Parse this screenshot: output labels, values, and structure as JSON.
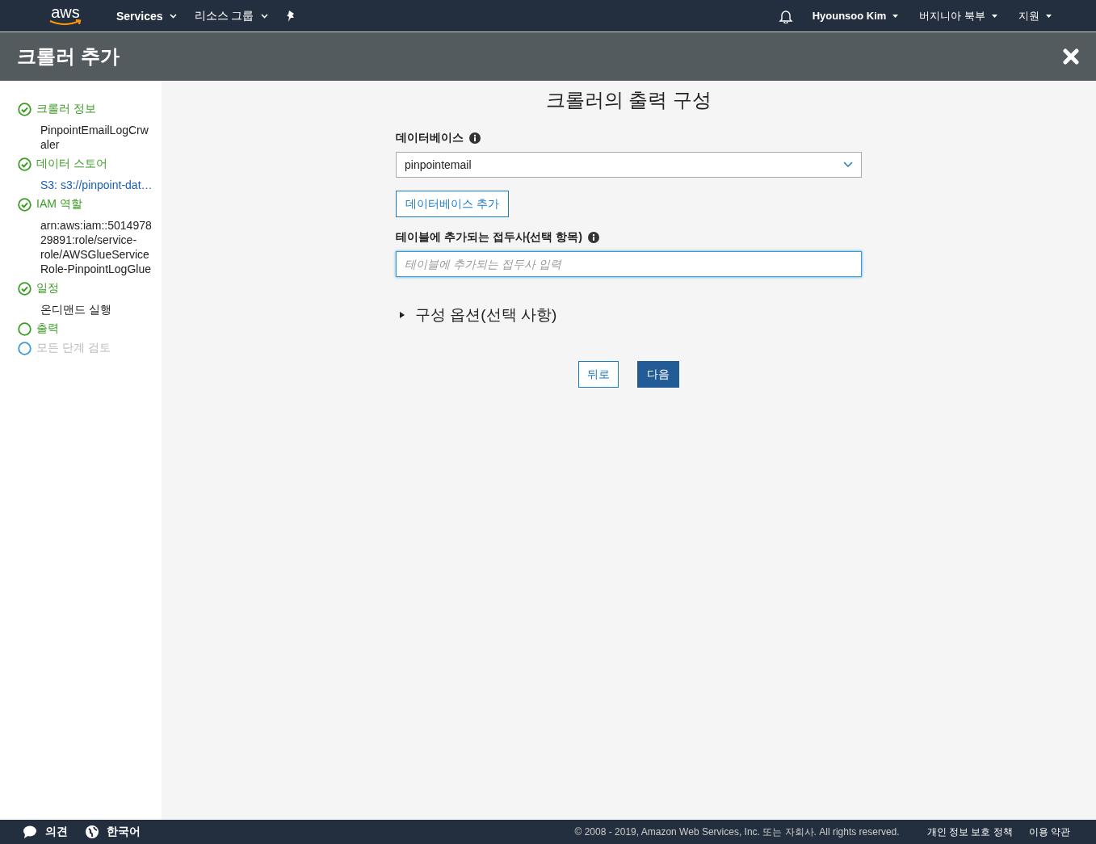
{
  "nav": {
    "logo": "aws",
    "services": "Services",
    "resource_groups": "리소스 그룹",
    "user": "Hyounsoo Kim",
    "region": "버지니아 북부",
    "support": "지원"
  },
  "header": {
    "title": "크롤러 추가"
  },
  "steps": [
    {
      "label": "크롤러 정보",
      "completed": true,
      "disabled": false,
      "detail": "PinpointEmailLogCrwaler",
      "detail_is_link": false
    },
    {
      "label": "데이터 스토어",
      "completed": true,
      "disabled": false,
      "detail": "S3: s3://pinpoint-dat…",
      "detail_is_link": true
    },
    {
      "label": "IAM 역할",
      "completed": true,
      "disabled": false,
      "detail": "arn:aws:iam::501497829891:role/service-role/AWSGlueServiceRole-PinpointLogGlue",
      "detail_is_link": false
    },
    {
      "label": "일정",
      "completed": true,
      "disabled": false,
      "detail": "온디맨드 실행",
      "detail_is_link": false
    },
    {
      "label": "출력",
      "completed": false,
      "disabled": false
    },
    {
      "label": "모든 단계 검토",
      "completed": false,
      "disabled": true
    }
  ],
  "form": {
    "heading": "크롤러의 출력 구성",
    "database_label": "데이터베이스",
    "database_value": "pinpointemail",
    "add_database": "데이터베이스 추가",
    "prefix_label": "테이블에 추가되는 접두사(선택 항목)",
    "prefix_placeholder": "테이블에 추가되는 접두사 입력",
    "options": {
      "label": "구성 옵션(선택 사항)",
      "expanded": false
    },
    "back": "뒤로",
    "next": "다음"
  },
  "footer": {
    "feedback": "의견",
    "language": "한국어",
    "copyright": "© 2008 - 2019, Amazon Web Services, Inc. 또는 자회사. All rights reserved.",
    "privacy": "개인 정보 보호 정책",
    "terms": "이용 약관"
  }
}
